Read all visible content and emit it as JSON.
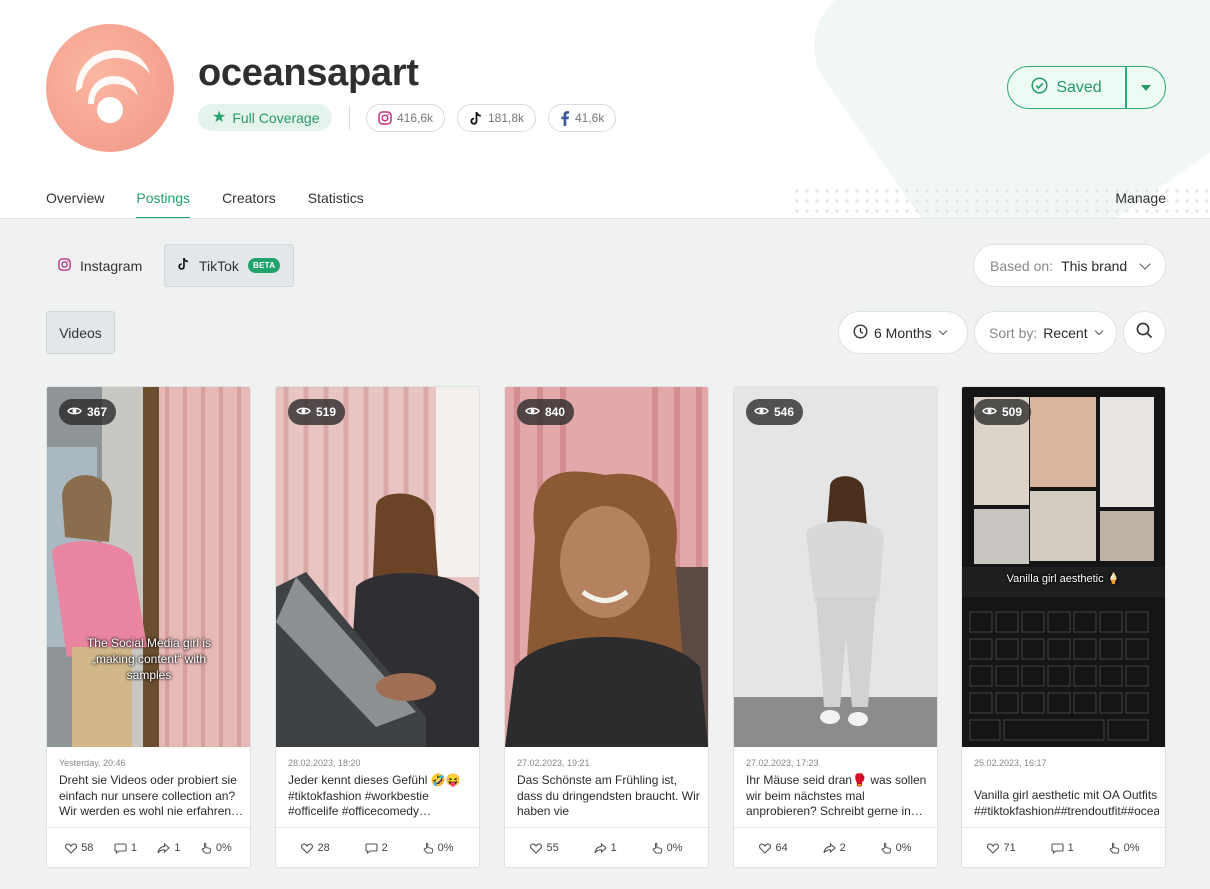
{
  "brand": {
    "name": "oceansapart",
    "coverage_label": "Full Coverage",
    "instagram_followers": "416,6k",
    "tiktok_followers": "181,8k",
    "facebook_followers": "41,6k",
    "saved_label": "Saved"
  },
  "tabs": [
    "Overview",
    "Postings",
    "Creators",
    "Statistics"
  ],
  "active_tab": "Postings",
  "manage_label": "Manage",
  "platforms": {
    "instagram": "Instagram",
    "tiktok": "TikTok",
    "beta_badge": "BETA"
  },
  "based_on": {
    "label": "Based on:",
    "value": "This brand"
  },
  "content_type": "Videos",
  "filters": {
    "period": "6 Months",
    "sort_label": "Sort by:",
    "sort_value": "Recent"
  },
  "posts": [
    {
      "views": "367",
      "date": "Yesterday, 20:46",
      "caption": "Dreht sie Videos oder probiert sie einfach nur unsere collection an? Wir werden es wohl nie erfahren…",
      "overlay": "The Social Media girl is „making content“ with samples",
      "stats": {
        "likes": "58",
        "comments": "1",
        "shares": "1",
        "engagement": "0%"
      }
    },
    {
      "views": "519",
      "date": "28.02.2023, 18:20",
      "caption": "Jeder kennt dieses Gefühl 🤣😝 #tiktokfashion #workbestie #officelife #officecomedy…",
      "overlay": "",
      "stats": {
        "likes": "28",
        "comments": "2",
        "engagement": "0%"
      }
    },
    {
      "views": "840",
      "date": "27.02.2023, 19:21",
      "caption": "Das Schönste am Frühling ist, dass du dringendsten braucht. Wir haben vie ##InstantInkFeelings##tiktokfashio",
      "overlay": "",
      "stats": {
        "likes": "55",
        "shares": "1",
        "engagement": "0%"
      }
    },
    {
      "views": "546",
      "date": "27.02.2023, 17:23",
      "caption": "Ihr Mäuse seid dran🥊 was sollen wir beim nächstes mal anprobieren? Schreibt gerne in…",
      "overlay": "",
      "stats": {
        "likes": "64",
        "shares": "2",
        "engagement": "0%"
      }
    },
    {
      "views": "509",
      "date": "25.02.2023, 16:17",
      "caption": "Vanilla girl aesthetic mit OA Outfits ##tiktokfashion##trendoutfit##ocea",
      "overlay": "Vanilla girl aesthetic 🍦",
      "stats": {
        "likes": "71",
        "comments": "1",
        "engagement": "0%"
      }
    }
  ],
  "colors": {
    "accent": "#23a06a",
    "saved_bg": "#eefaf4",
    "page_bg": "#f0f2f2"
  }
}
